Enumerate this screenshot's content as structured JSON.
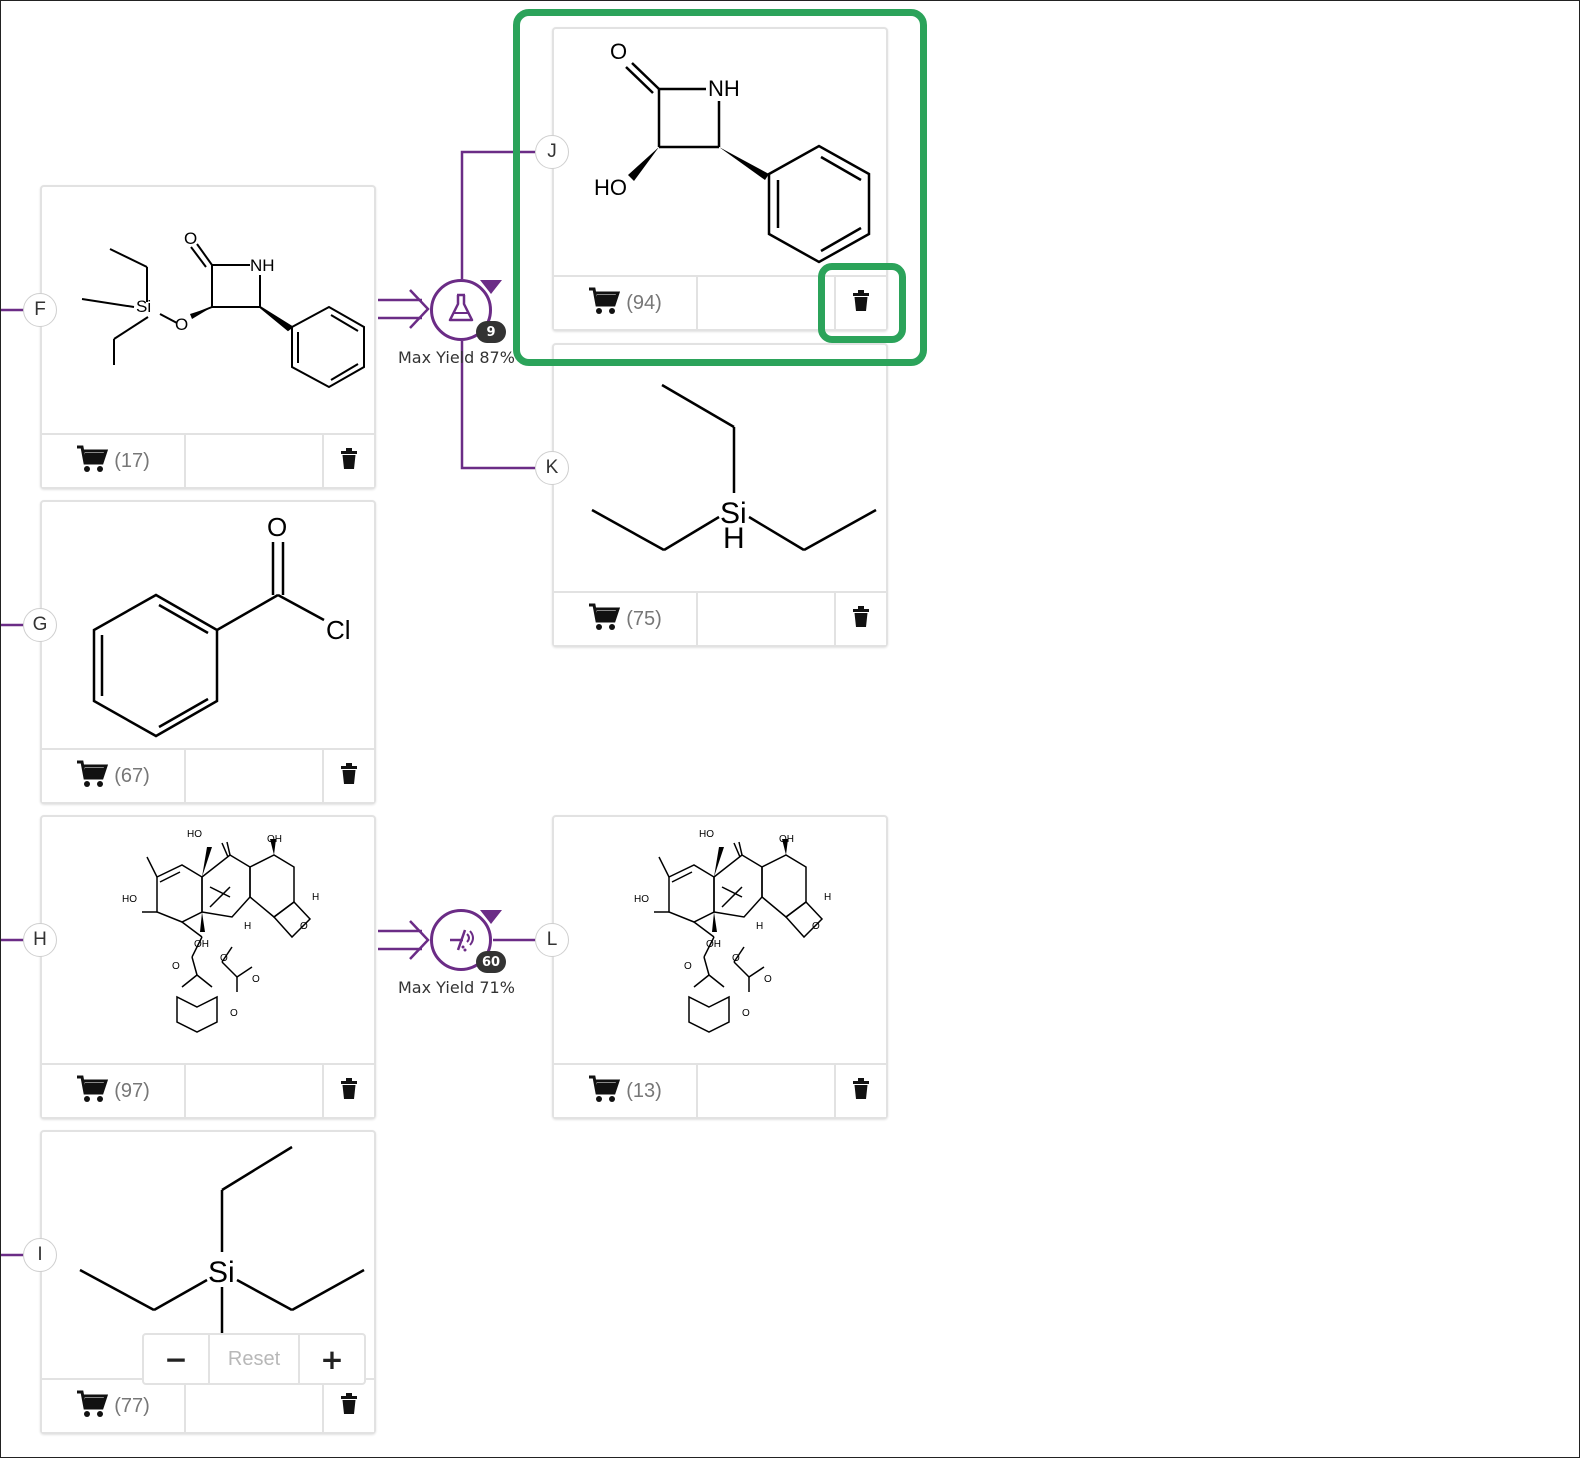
{
  "nodes": {
    "F": {
      "label": "F",
      "count": "(17)"
    },
    "G": {
      "label": "G",
      "count": "(67)"
    },
    "H": {
      "label": "H",
      "count": "(97)"
    },
    "I": {
      "label": "I",
      "count": "(77)"
    },
    "J": {
      "label": "J",
      "count": "(94)"
    },
    "K": {
      "label": "K",
      "count": "(75)"
    },
    "L": {
      "label": "L",
      "count": "(13)"
    }
  },
  "reactions": [
    {
      "badge": "9",
      "yield": "Max Yield 87%",
      "icon": "flask-icon"
    },
    {
      "badge": "60",
      "yield": "Max Yield 71%",
      "icon": "hydrogenation-icon"
    }
  ],
  "atoms": {
    "o": "O",
    "nh": "NH",
    "si": "Si",
    "ho": "HO",
    "oh": "OH",
    "cl": "Cl",
    "h": "H"
  },
  "zoom": {
    "minus": "−",
    "reset": "Reset",
    "plus": "+"
  },
  "colors": {
    "accent": "#6b2c86",
    "highlight": "#2ba35a"
  },
  "icons": {
    "cart": "cart-icon",
    "delete": "trash-icon"
  }
}
